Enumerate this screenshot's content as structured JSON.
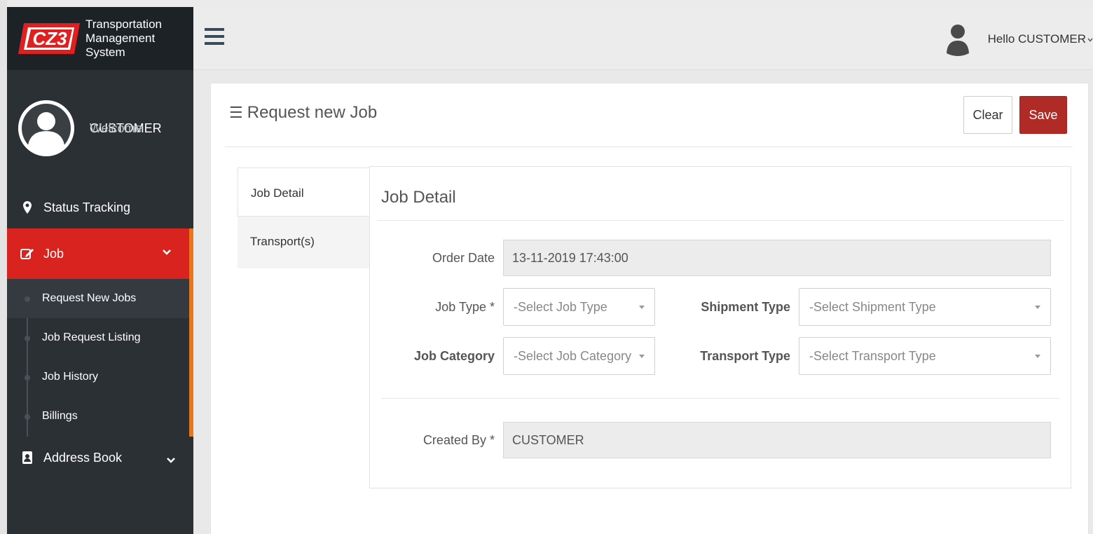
{
  "app": {
    "logo_text": "CZ3",
    "title_line1": "Transportation",
    "title_line2": "Management System"
  },
  "profile": {
    "welcome": "Welcome",
    "name": "CUSTOMER"
  },
  "sidebar": {
    "items": [
      {
        "label": "Status Tracking",
        "icon": "map-marker-icon"
      },
      {
        "label": "Job",
        "icon": "edit-icon"
      },
      {
        "label": "Address Book",
        "icon": "address-book-icon"
      }
    ],
    "job_submenu": [
      {
        "label": "Request New Jobs"
      },
      {
        "label": "Job Request Listing"
      },
      {
        "label": "Job History"
      },
      {
        "label": "Billings"
      }
    ]
  },
  "topbar": {
    "hello": "Hello CUSTOMER"
  },
  "page": {
    "title": "Request new Job",
    "clear_label": "Clear",
    "save_label": "Save"
  },
  "tabs": [
    {
      "label": "Job Detail"
    },
    {
      "label": "Transport(s)"
    }
  ],
  "form": {
    "section_title": "Job Detail",
    "order_date_label": "Order Date",
    "order_date_value": "13-11-2019 17:43:00",
    "job_type_label": "Job Type *",
    "job_type_value": "-Select Job Type",
    "shipment_type_label": "Shipment Type",
    "shipment_type_value": "-Select Shipment Type",
    "job_category_label": "Job Category",
    "job_category_value": "-Select Job Category",
    "transport_type_label": "Transport Type",
    "transport_type_value": "-Select Transport Type",
    "created_by_label": "Created By *",
    "created_by_value": "CUSTOMER"
  },
  "colors": {
    "sidebar_bg": "#2b3035",
    "brand_bg": "#1d2226",
    "active_red": "#d8231f",
    "accent_orange": "#e8761b",
    "save_red": "#b02a26"
  }
}
